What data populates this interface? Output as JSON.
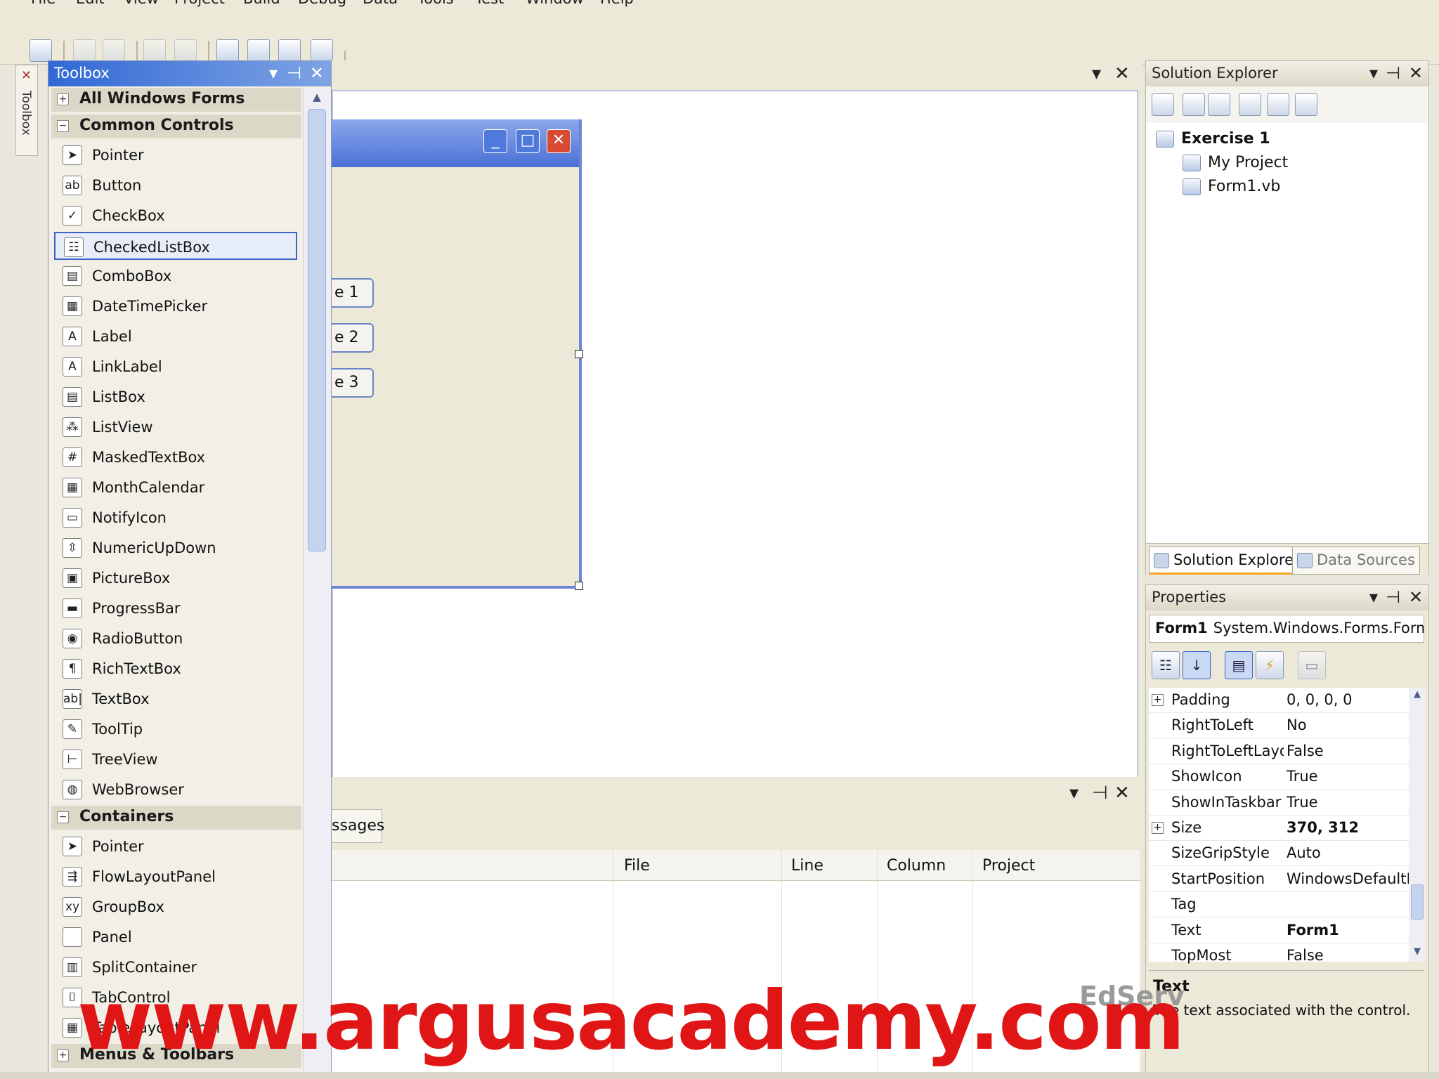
{
  "menu": [
    "File",
    "Edit",
    "View",
    "Project",
    "Build",
    "Debug",
    "Data",
    "Tools",
    "Test",
    "Window",
    "Help"
  ],
  "side_tab": {
    "label": "Toolbox"
  },
  "toolbox": {
    "title": "Toolbox",
    "categories": [
      {
        "label": "All Windows Forms",
        "expanded": false
      },
      {
        "label": "Common Controls",
        "expanded": true
      },
      {
        "label": "Containers",
        "expanded": true
      },
      {
        "label": "Menus & Toolbars",
        "expanded": false
      }
    ],
    "common_items": [
      {
        "label": "Pointer",
        "icon": "pointer-icon",
        "glyph": "➤"
      },
      {
        "label": "Button",
        "icon": "button-icon",
        "glyph": "ab"
      },
      {
        "label": "CheckBox",
        "icon": "checkbox-icon",
        "glyph": "✓"
      },
      {
        "label": "CheckedListBox",
        "icon": "checkedlistbox-icon",
        "glyph": "☷",
        "selected": true
      },
      {
        "label": "ComboBox",
        "icon": "combobox-icon",
        "glyph": "▤"
      },
      {
        "label": "DateTimePicker",
        "icon": "datetimepicker-icon",
        "glyph": "▦"
      },
      {
        "label": "Label",
        "icon": "label-icon",
        "glyph": "A"
      },
      {
        "label": "LinkLabel",
        "icon": "linklabel-icon",
        "glyph": "A"
      },
      {
        "label": "ListBox",
        "icon": "listbox-icon",
        "glyph": "▤"
      },
      {
        "label": "ListView",
        "icon": "listview-icon",
        "glyph": "⁂"
      },
      {
        "label": "MaskedTextBox",
        "icon": "maskedtextbox-icon",
        "glyph": "#"
      },
      {
        "label": "MonthCalendar",
        "icon": "monthcalendar-icon",
        "glyph": "▦"
      },
      {
        "label": "NotifyIcon",
        "icon": "notifyicon-icon",
        "glyph": "▭"
      },
      {
        "label": "NumericUpDown",
        "icon": "numericupdown-icon",
        "glyph": "⇳"
      },
      {
        "label": "PictureBox",
        "icon": "picturebox-icon",
        "glyph": "▣"
      },
      {
        "label": "ProgressBar",
        "icon": "progressbar-icon",
        "glyph": "▬"
      },
      {
        "label": "RadioButton",
        "icon": "radiobutton-icon",
        "glyph": "◉"
      },
      {
        "label": "RichTextBox",
        "icon": "richtextbox-icon",
        "glyph": "¶"
      },
      {
        "label": "TextBox",
        "icon": "textbox-icon",
        "glyph": "ab|"
      },
      {
        "label": "ToolTip",
        "icon": "tooltip-icon",
        "glyph": "✎"
      },
      {
        "label": "TreeView",
        "icon": "treeview-icon",
        "glyph": "⊢"
      },
      {
        "label": "WebBrowser",
        "icon": "webbrowser-icon",
        "glyph": "◍"
      }
    ],
    "container_items": [
      {
        "label": "Pointer",
        "icon": "pointer-icon",
        "glyph": "➤"
      },
      {
        "label": "FlowLayoutPanel",
        "icon": "flowlayoutpanel-icon",
        "glyph": "⇶"
      },
      {
        "label": "GroupBox",
        "icon": "groupbox-icon",
        "glyph": "xy"
      },
      {
        "label": "Panel",
        "icon": "panel-icon",
        "glyph": " "
      },
      {
        "label": "SplitContainer",
        "icon": "splitcontainer-icon",
        "glyph": "▥"
      },
      {
        "label": "TabControl",
        "icon": "tabcontrol-icon",
        "glyph": "⌷"
      },
      {
        "label": "TableLayoutPanel",
        "icon": "tablelayoutpanel-icon",
        "glyph": "▦"
      }
    ]
  },
  "designer": {
    "form_buttons": [
      "e 1",
      "e 2",
      "e 3"
    ]
  },
  "errorlist": {
    "tab_label": "ssages",
    "columns": [
      "File",
      "Line",
      "Column",
      "Project"
    ]
  },
  "solution_explorer": {
    "title": "Solution Explorer",
    "tree": {
      "root": "Exercise 1",
      "children": [
        "My Project",
        "Form1.vb"
      ]
    },
    "tabs": [
      "Solution Explorer",
      "Data Sources"
    ]
  },
  "properties": {
    "title": "Properties",
    "object_name": "Form1",
    "object_type": "System.Windows.Forms.Form",
    "rows": [
      {
        "name": "Padding",
        "value": "0, 0, 0, 0",
        "expandable": true
      },
      {
        "name": "RightToLeft",
        "value": "No"
      },
      {
        "name": "RightToLeftLayout",
        "value": "False"
      },
      {
        "name": "ShowIcon",
        "value": "True"
      },
      {
        "name": "ShowInTaskbar",
        "value": "True"
      },
      {
        "name": "Size",
        "value": "370, 312",
        "expandable": true,
        "bold": true
      },
      {
        "name": "SizeGripStyle",
        "value": "Auto"
      },
      {
        "name": "StartPosition",
        "value": "WindowsDefaultLocation"
      },
      {
        "name": "Tag",
        "value": ""
      },
      {
        "name": "Text",
        "value": "Form1",
        "bold": true
      },
      {
        "name": "TopMost",
        "value": "False"
      }
    ],
    "description_title": "Text",
    "description": "The text associated with the control."
  },
  "watermark": "www.argusacademy.com",
  "brand_mark": "EdServ",
  "colors": {
    "title_active": "#3168d5",
    "watermark": "#e01616",
    "form_border": "#6c86d6"
  }
}
